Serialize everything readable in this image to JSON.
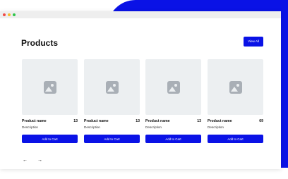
{
  "colors": {
    "accent": "#0a12e6",
    "placeholder_bg": "#eceff1",
    "placeholder_icon": "#a9afb6"
  },
  "header": {
    "title": "Products",
    "view_all_label": "View All"
  },
  "products": [
    {
      "name": "Product name",
      "price": "13",
      "description": "Description",
      "button_label": "Add to Cart",
      "image_icon": "image-placeholder-icon"
    },
    {
      "name": "Product name",
      "price": "13",
      "description": "Description",
      "button_label": "Add to Cart",
      "image_icon": "image-placeholder-icon"
    },
    {
      "name": "Product name",
      "price": "13",
      "description": "Description",
      "button_label": "Add to Cart",
      "image_icon": "image-placeholder-icon"
    },
    {
      "name": "Product name",
      "price": "69",
      "description": "Description",
      "button_label": "Add to Cart",
      "image_icon": "image-placeholder-icon"
    }
  ],
  "pagination": {
    "prev_icon": "arrow-left-icon",
    "next_icon": "arrow-right-icon",
    "prev_glyph": "←",
    "next_glyph": "→"
  }
}
